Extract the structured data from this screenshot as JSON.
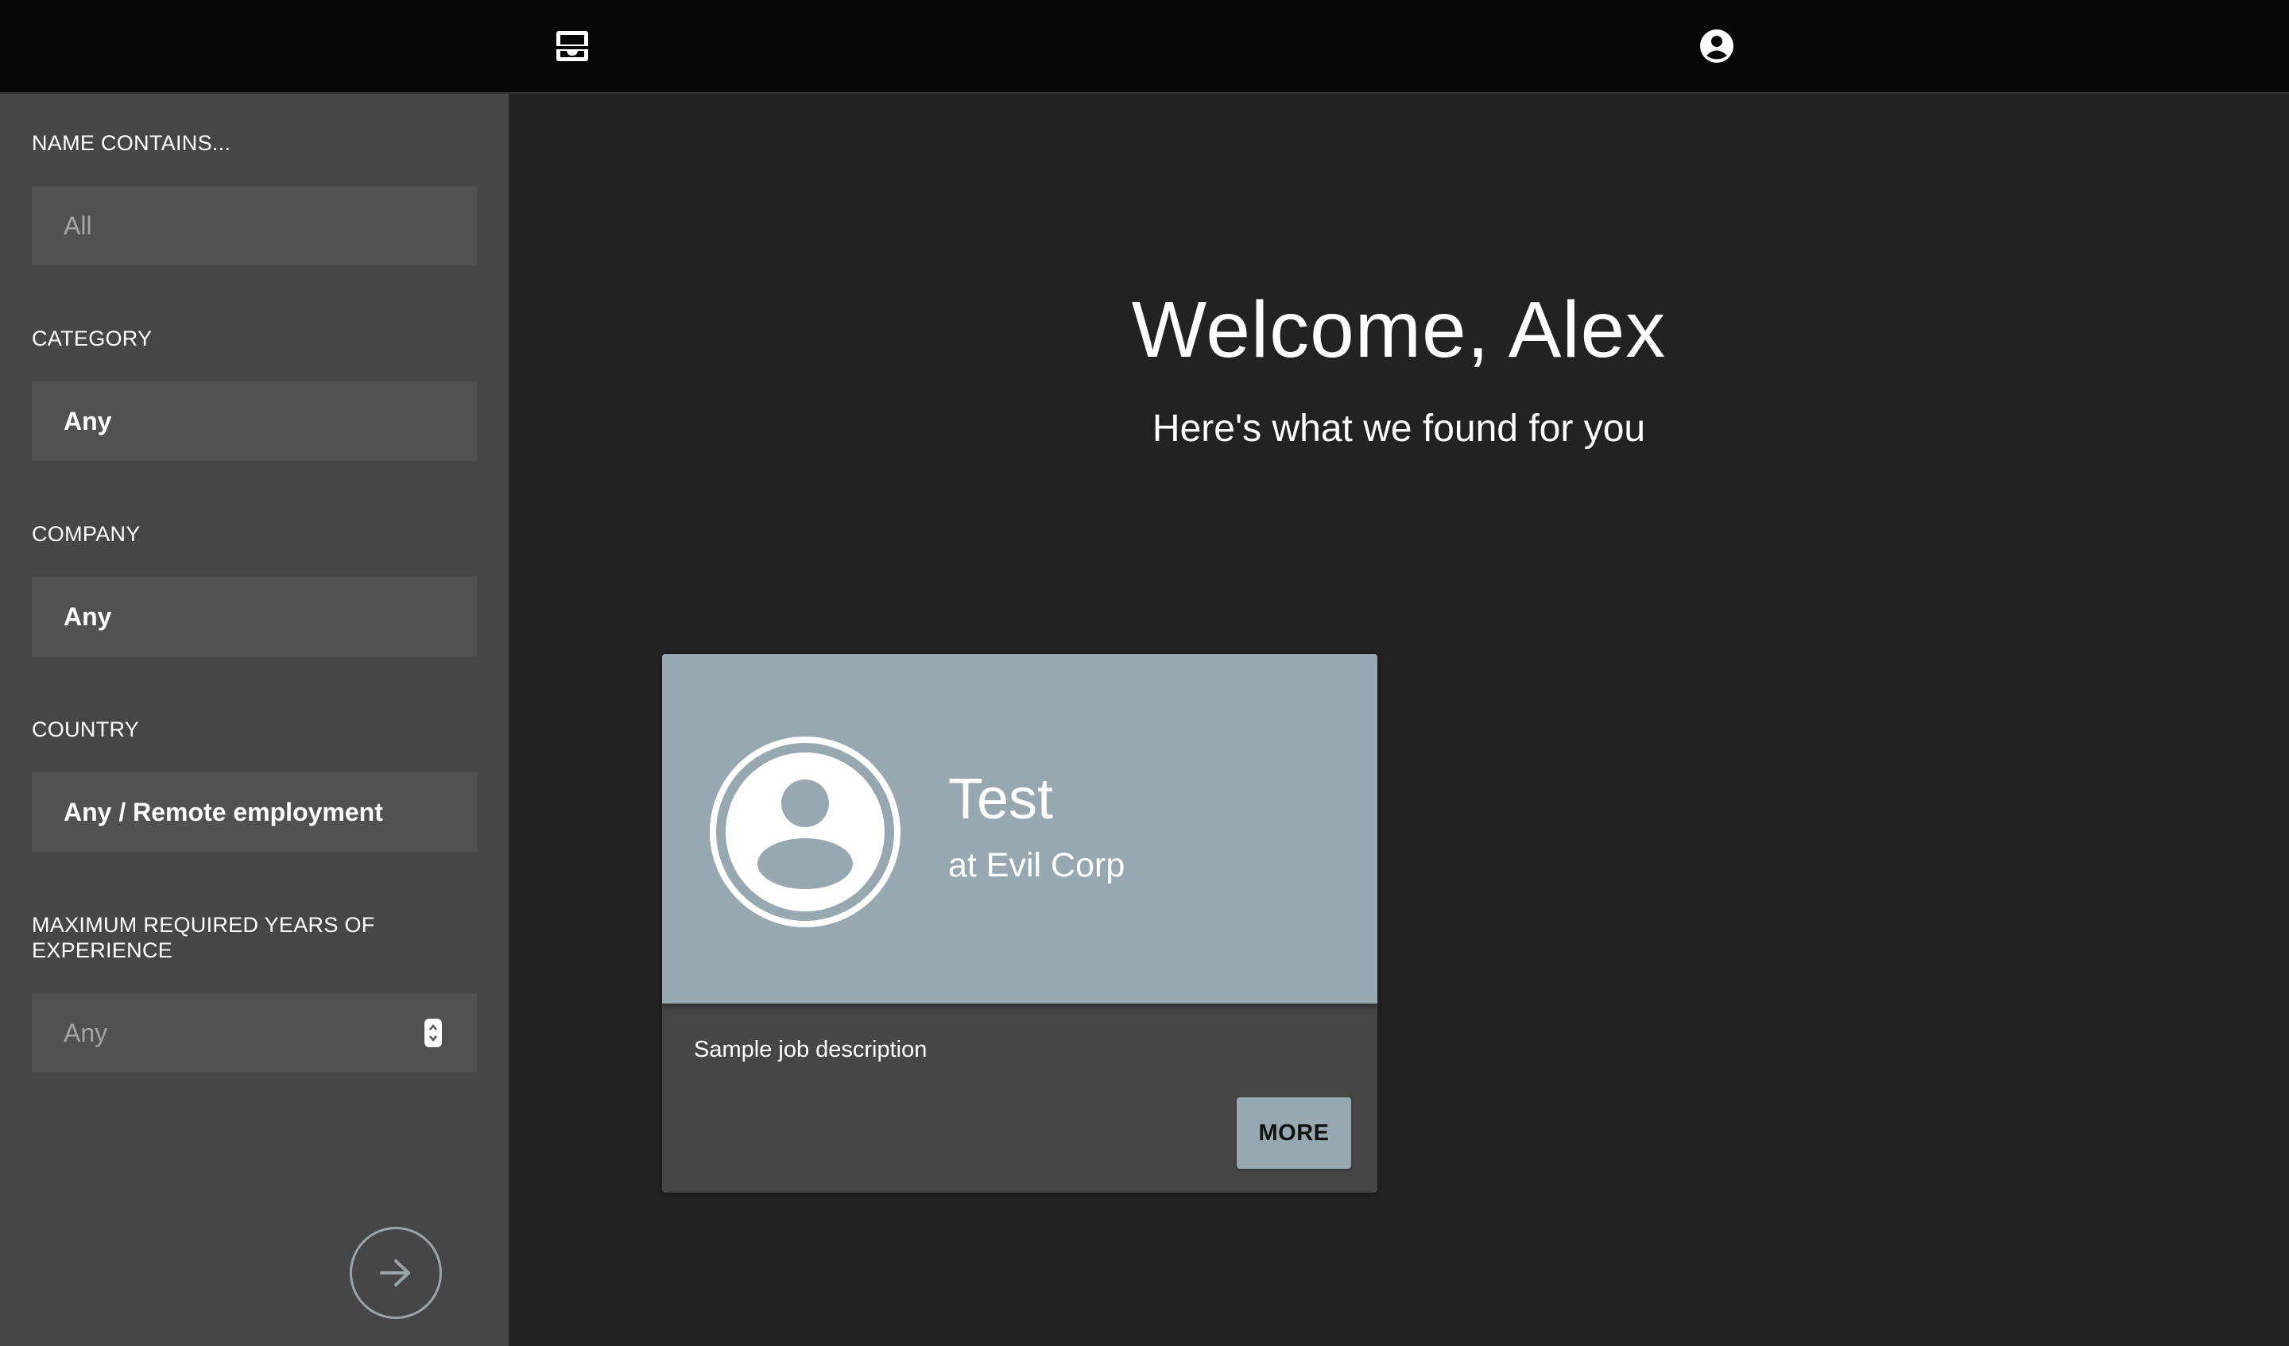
{
  "topbar": {
    "inbox_icon": "inbox-icon",
    "account_icon": "account-circle-icon"
  },
  "filters": {
    "name": {
      "label": "NAME CONTAINS...",
      "placeholder": "All"
    },
    "category": {
      "label": "CATEGORY",
      "value": "Any"
    },
    "company": {
      "label": "COMPANY",
      "value": "Any"
    },
    "country": {
      "label": "COUNTRY",
      "value": "Any / Remote employment"
    },
    "experience": {
      "label": "MAXIMUM REQUIRED YEARS OF EXPERIENCE",
      "placeholder": "Any"
    },
    "submit_icon": "arrow-right-icon"
  },
  "main": {
    "welcome": "Welcome, Alex",
    "subheading": "Here's what we found for you"
  },
  "job_card": {
    "title": "Test",
    "company": "at Evil Corp",
    "description": "Sample job description",
    "more_label": "MORE",
    "avatar_icon": "account-circle-icon"
  },
  "colors": {
    "topbar": "#070707",
    "sidebar": "#464646",
    "field": "#515151",
    "background": "#222222",
    "accent": "#98a8b0"
  }
}
